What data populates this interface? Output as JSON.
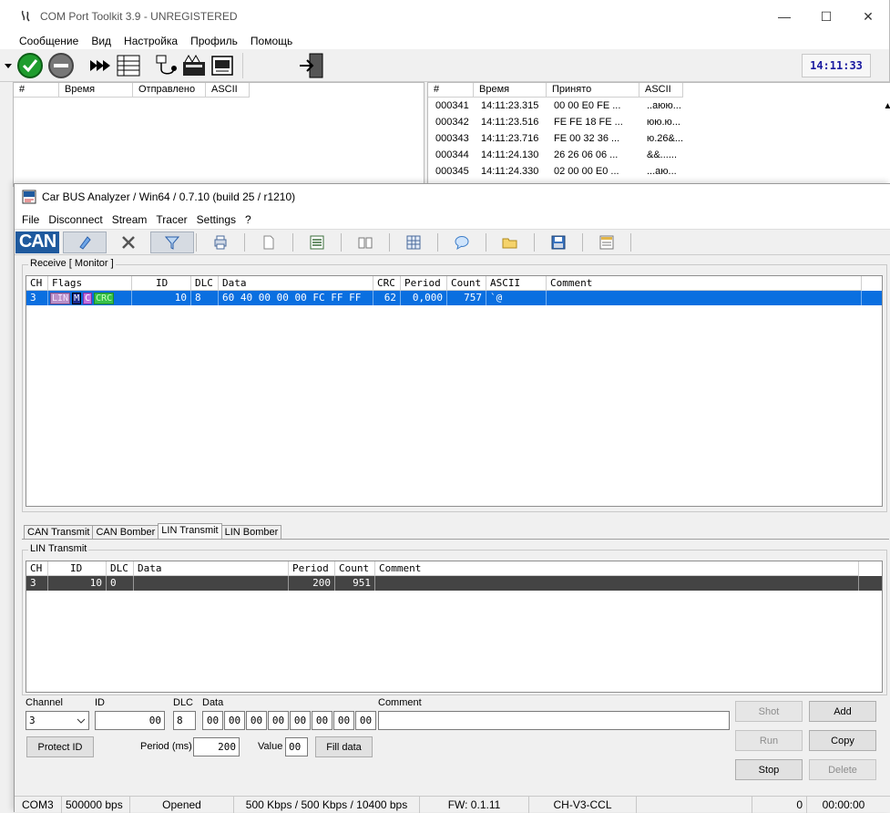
{
  "cpt": {
    "title": "COM Port Toolkit 3.9 - UNREGISTERED",
    "menu": [
      "Сообщение",
      "Вид",
      "Настройка",
      "Профиль",
      "Помощь"
    ],
    "clock": "14:11:33",
    "sent_headers": [
      "#",
      "Время",
      "Отправлено",
      "ASCII"
    ],
    "recv_headers": [
      "#",
      "Время",
      "Принято",
      "ASCII"
    ],
    "recv_rows": [
      [
        "000341",
        "14:11:23.315",
        "00 00 E0 FE ...",
        "..аюю..."
      ],
      [
        "000342",
        "14:11:23.516",
        "FE FE 18 FE ...",
        "юю.ю..."
      ],
      [
        "000343",
        "14:11:23.716",
        "FE 00 32 36 ...",
        "ю.26&..."
      ],
      [
        "000344",
        "14:11:24.130",
        "26 26 06 06 ...",
        "&&......"
      ],
      [
        "000345",
        "14:11:24.330",
        "02 00 00 E0 ...",
        "...аю..."
      ]
    ],
    "icons": [
      "dropdown-arrow-icon",
      "connect-check-icon",
      "disconnect-icon",
      "send-fast-icon",
      "log-sheet-icon",
      "port-cable-icon",
      "scripts-icon",
      "terminal-icon",
      "exit-door-icon"
    ]
  },
  "cba": {
    "title": "Car BUS Analyzer / Win64 / 0.7.10 (build 25 / r1210)",
    "menu": [
      "File",
      "Disconnect",
      "Stream",
      "Tracer",
      "Settings",
      "?"
    ],
    "logo": "CAN",
    "receive": {
      "group_label": "Receive [ Monitor ]",
      "headers": [
        "CH",
        "Flags",
        "ID",
        "DLC",
        "Data",
        "CRC",
        "Period",
        "Count",
        "ASCII",
        "Comment"
      ],
      "row": {
        "ch": "3",
        "flags": [
          "LIN",
          "M",
          "C",
          "CRC"
        ],
        "id": "10",
        "dlc": "8",
        "data": "60 40 00 00 00 FC FF FF",
        "crc": "62",
        "period": "0,000",
        "count": "757",
        "ascii": "`@",
        "comment": ""
      }
    },
    "tabs": [
      "CAN Transmit",
      "CAN Bomber",
      "LIN Transmit",
      "LIN Bomber"
    ],
    "active_tab": "LIN Transmit",
    "lin_transmit": {
      "group_label": "LIN Transmit",
      "headers": [
        "CH",
        "ID",
        "DLC",
        "Data",
        "Period",
        "Count",
        "Comment"
      ],
      "row": {
        "ch": "3",
        "id": "10",
        "dlc": "0",
        "data": "",
        "period": "200",
        "count": "951",
        "comment": ""
      }
    },
    "form": {
      "channel_label": "Channel",
      "channel_value": "3",
      "id_label": "ID",
      "id_value": "00",
      "dlc_label": "DLC",
      "dlc_value": "8",
      "data_label": "Data",
      "data_bytes": [
        "00",
        "00",
        "00",
        "00",
        "00",
        "00",
        "00",
        "00"
      ],
      "comment_label": "Comment",
      "comment_value": "",
      "protect_id": "Protect ID",
      "period_label": "Period (ms)",
      "period_value": "200",
      "value_label": "Value",
      "value_value": "00",
      "fill_data": "Fill data",
      "shot": "Shot",
      "add": "Add",
      "run": "Run",
      "copy": "Copy",
      "stop": "Stop",
      "delete": "Delete"
    },
    "status": {
      "port": "COM3",
      "baud": "500000 bps",
      "state": "Opened",
      "rates": "500 Kbps / 500 Kbps / 10400 bps",
      "fw": "FW: 0.1.11",
      "device": "CH-V3-CCL",
      "errors": "0",
      "time": "00:00:00"
    },
    "toolbar_icons": [
      "monitor-icon",
      "tools-icon",
      "filter-icon",
      "print-icon",
      "new-document-icon",
      "log-icon",
      "book-icon",
      "grid-icon",
      "comment-icon",
      "open-folder-icon",
      "save-icon",
      "report-icon"
    ]
  },
  "colors": {
    "selection": "#0a6fe0",
    "dark_row": "#444444",
    "logo_bg": "#1f5a9e",
    "clock_text": "#1a1aa0"
  }
}
